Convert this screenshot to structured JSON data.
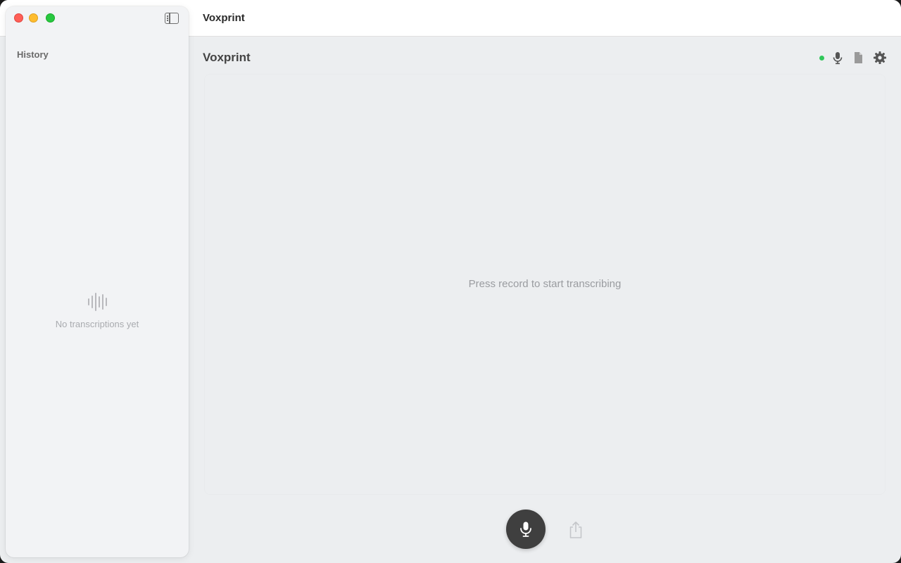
{
  "window": {
    "title": "Voxprint"
  },
  "sidebar": {
    "title": "History",
    "empty_message": "No transcriptions yet",
    "toggle_icon": "sidebar-toggle-icon"
  },
  "main": {
    "title": "Voxprint",
    "status_color": "#31c75a",
    "placeholder": "Press record to start transcribing",
    "header_icons": [
      "microphone-icon",
      "document-icon",
      "gear-icon"
    ]
  },
  "controls": {
    "record_icon": "microphone-icon",
    "share_icon": "share-icon"
  },
  "colors": {
    "close": "#ff5f57",
    "minimize": "#febc2e",
    "zoom": "#28c840",
    "record_button": "#3f3f3f"
  }
}
